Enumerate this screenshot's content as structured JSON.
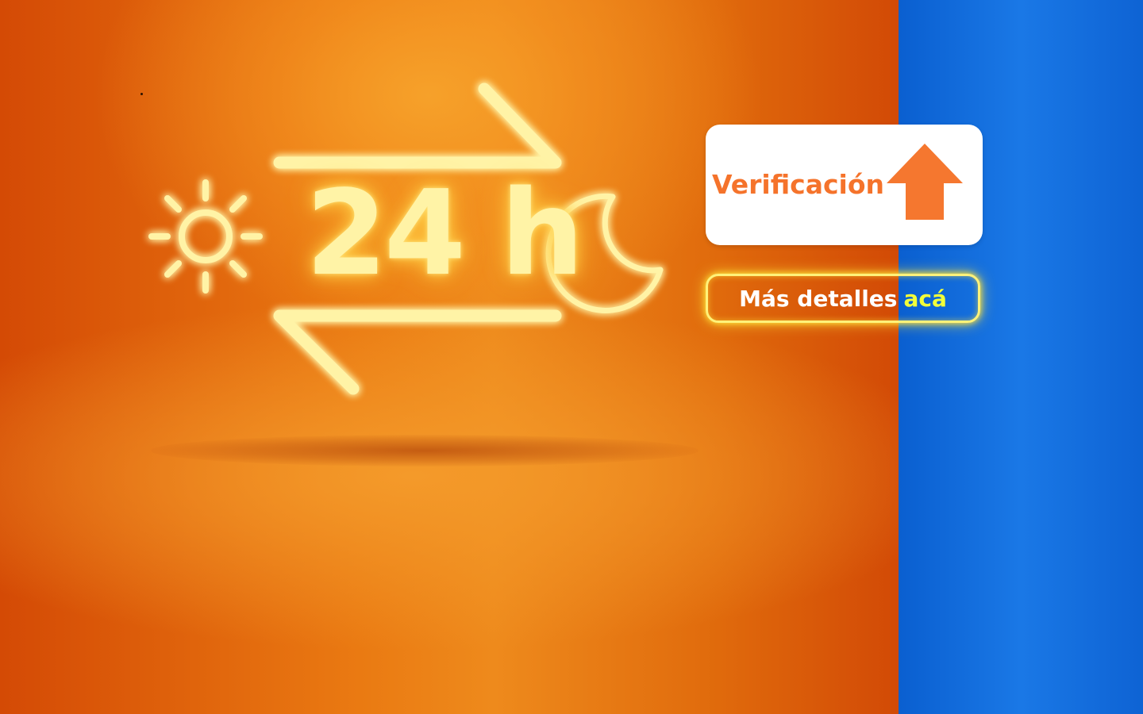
{
  "hero": {
    "badge_text": "24 h",
    "icons": [
      "sun-icon",
      "moon-icon",
      "arrow-right-icon",
      "arrow-left-icon"
    ]
  },
  "verify_card": {
    "label": "Verificación",
    "icon": "arrow-up-icon"
  },
  "details_button": {
    "text": "Más detalles",
    "link_text": "acá"
  },
  "colors": {
    "orange_panel": "#e8760f",
    "blue_panel": "#1470dd",
    "neon_yellow": "#fff3a6",
    "accent_orange": "#f5732b",
    "link_yellow": "#f2ff3a"
  }
}
